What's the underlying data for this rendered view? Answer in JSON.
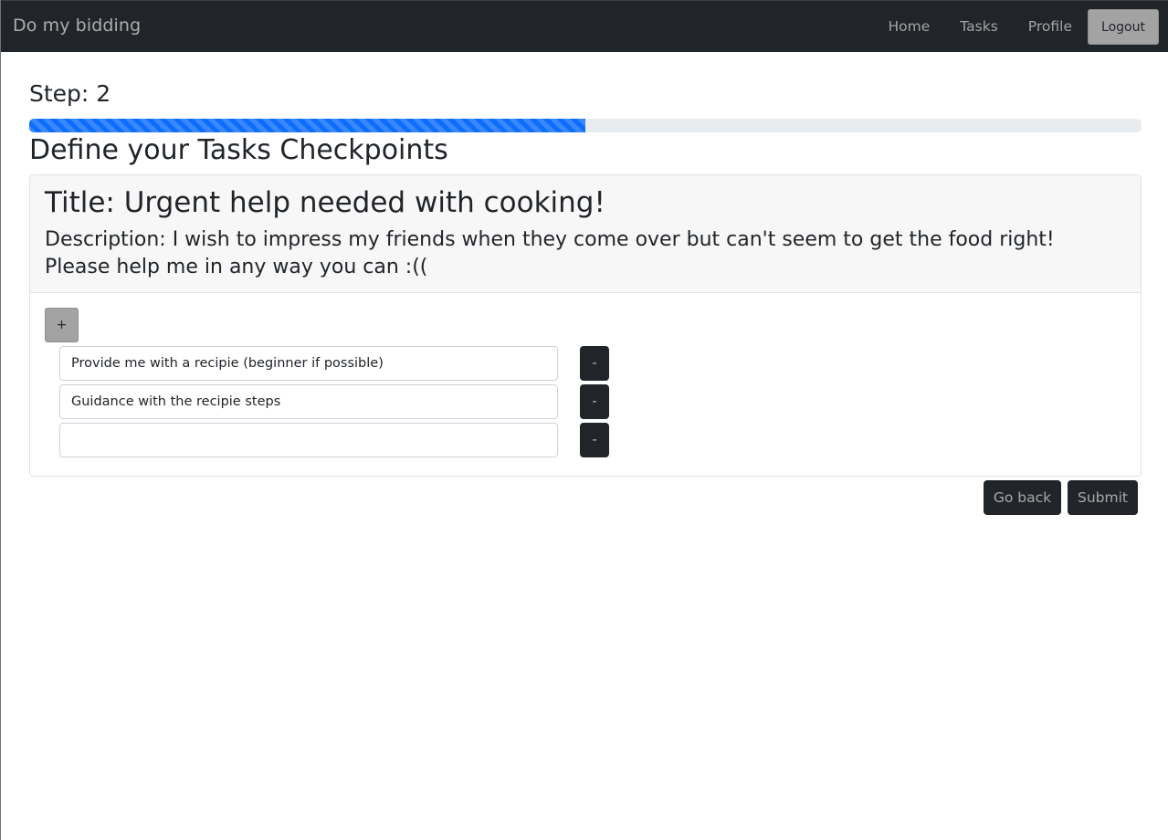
{
  "navbar": {
    "brand": "Do my bidding",
    "links": [
      "Home",
      "Tasks",
      "Profile"
    ],
    "logout_label": "Logout"
  },
  "wizard": {
    "step_label": "Step: 2",
    "progress_fraction": 0.5,
    "section_title": "Define your Tasks Checkpoints"
  },
  "task": {
    "title": "Title: Urgent help needed with cooking!",
    "description": "Description: I wish to impress my friends when they come over but can't seem to get the food right! Please help me in any way you can :(("
  },
  "checkpoints": {
    "add_label": "+",
    "remove_label": "-",
    "items": [
      "Provide me with a recipie (beginner if possible)",
      "Guidance with the recipie steps",
      ""
    ]
  },
  "actions": {
    "back_label": "Go back",
    "submit_label": "Submit"
  },
  "colors": {
    "navbar_bg": "#212529",
    "progress_fill": "#0d6efd",
    "progress_track": "#e9ecef",
    "button_dark": "#212529",
    "button_grey": "#a3a3a3"
  }
}
